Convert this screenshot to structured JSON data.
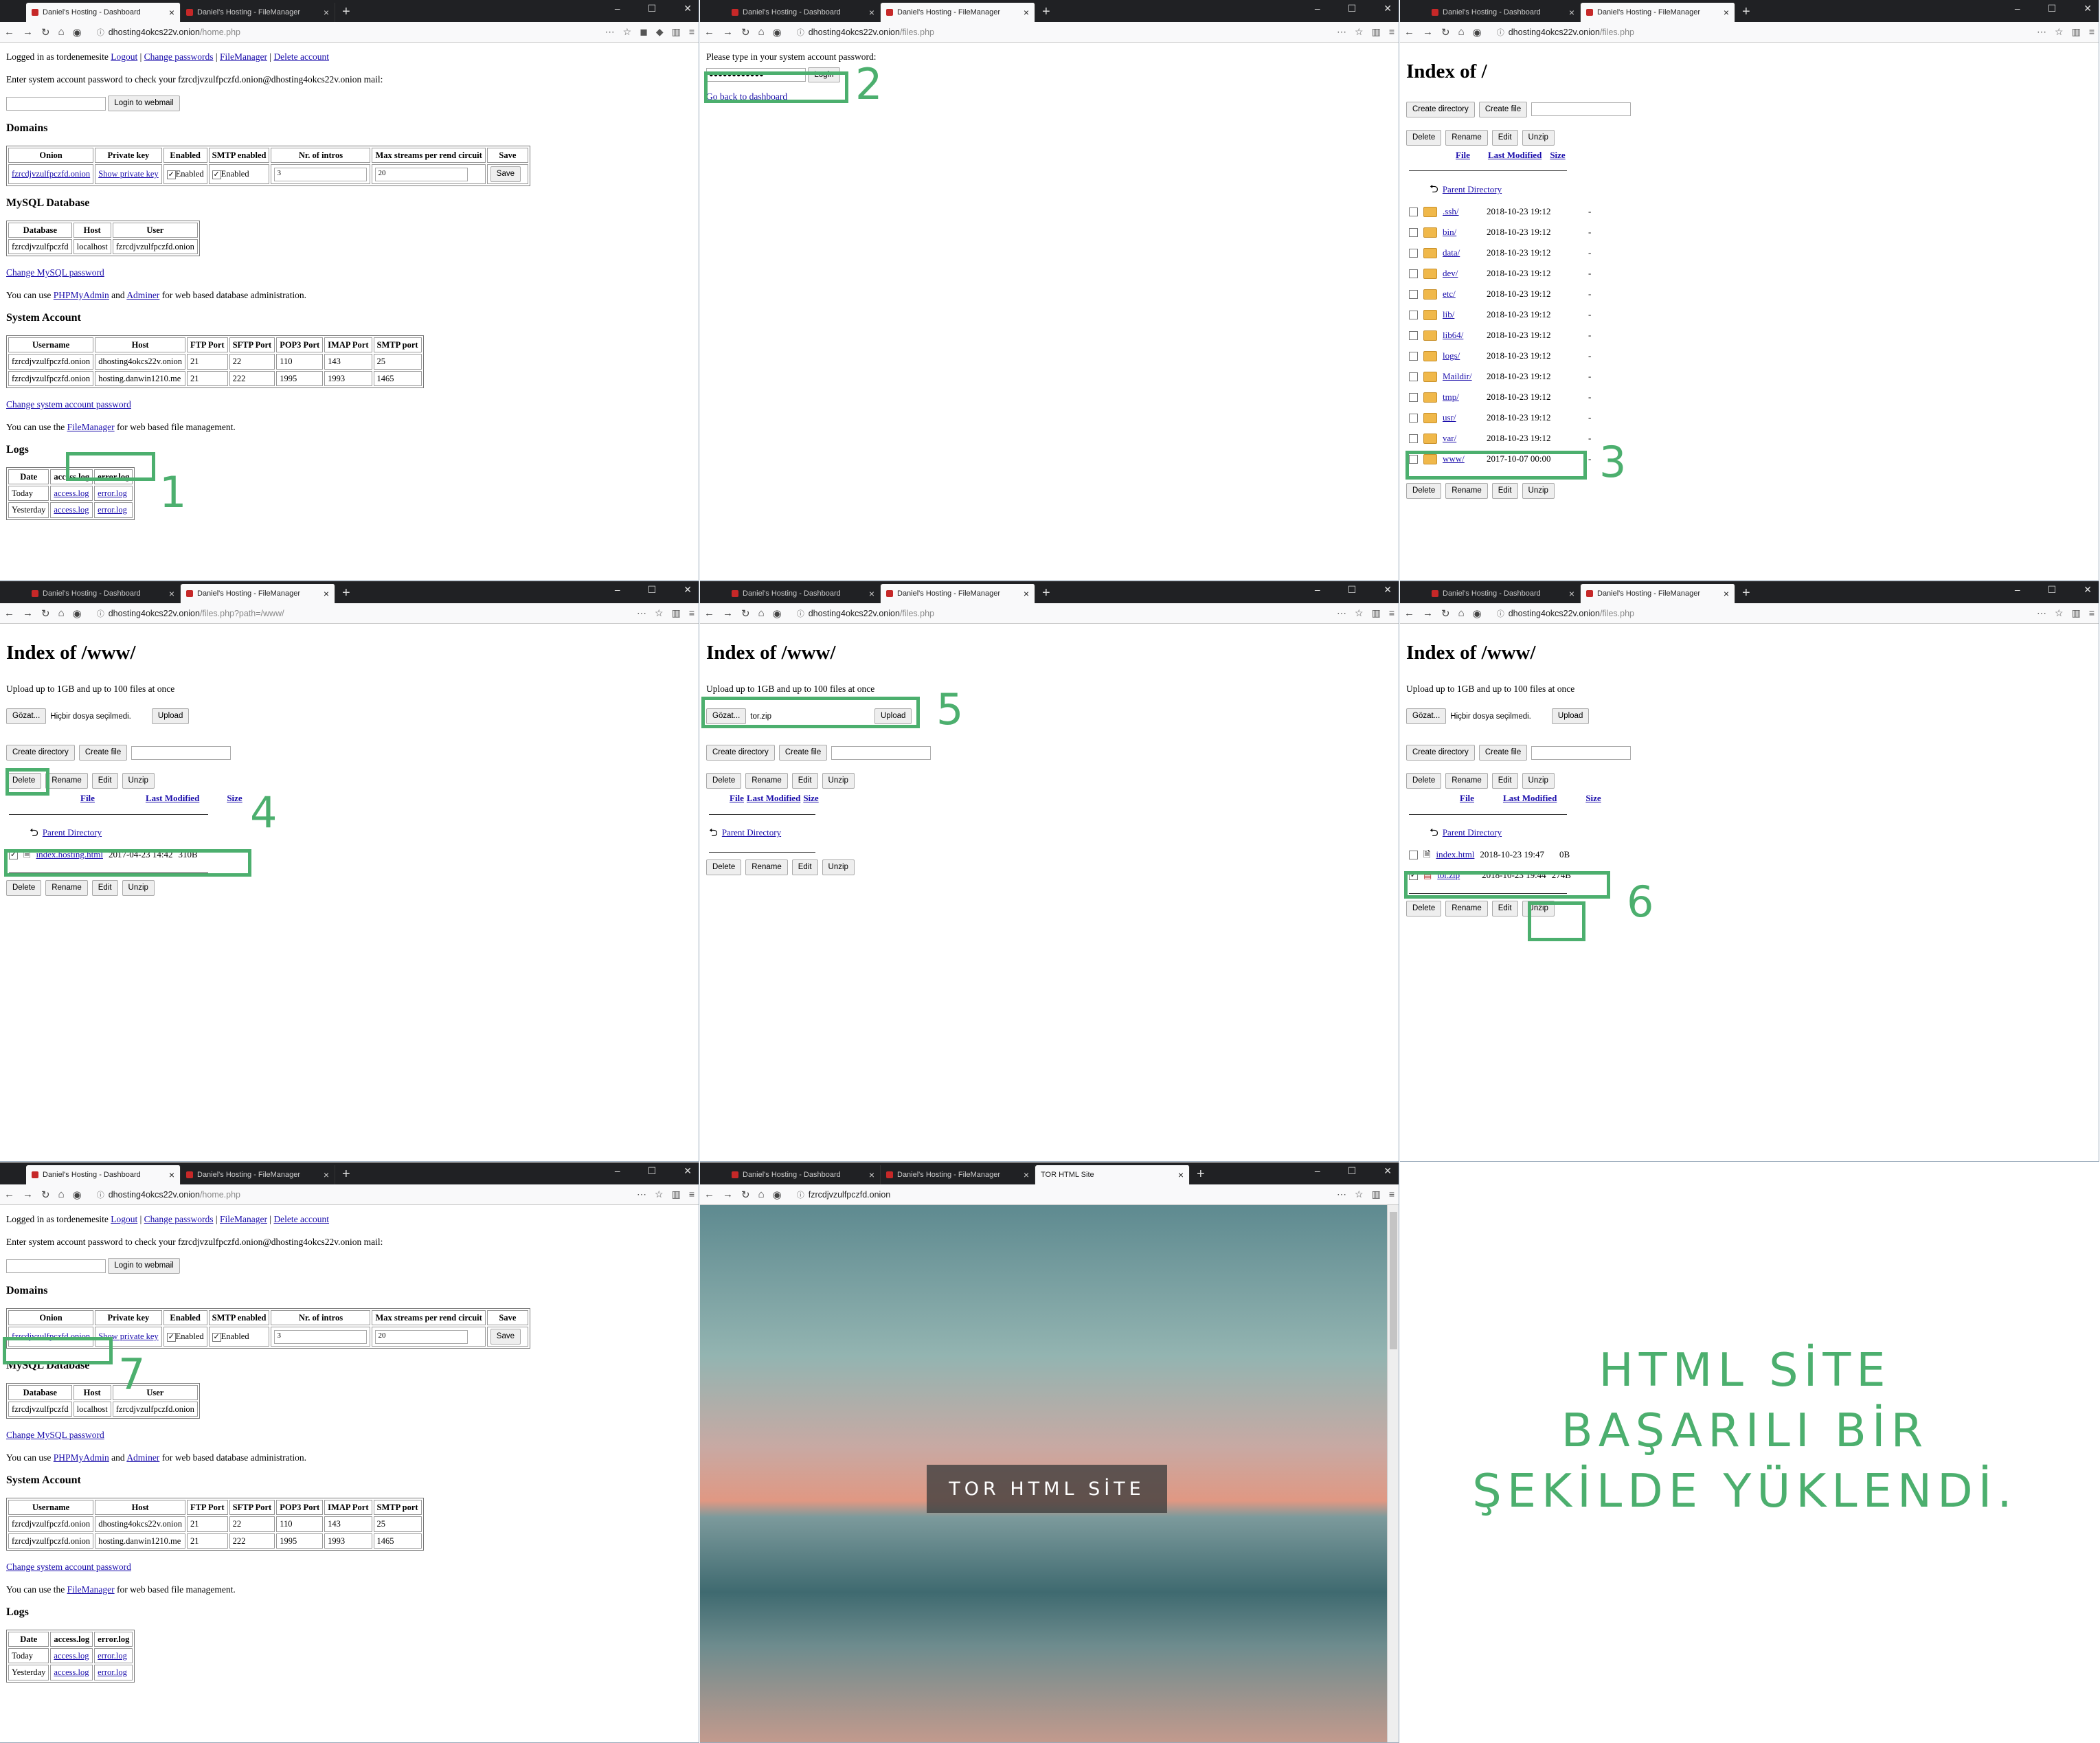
{
  "colors": {
    "accent": "#4caf6e",
    "link": "#1a0dab"
  },
  "browser": {
    "tab_dashboard": "Daniel's Hosting - Dashboard",
    "tab_filemanager": "Daniel's Hosting - FileManager",
    "tab_torsite": "TOR HTML Site",
    "new_tab": "+",
    "url_host": "dhosting4okcs22v.onion",
    "url_home": "/home.php",
    "url_files": "/files.php",
    "url_files_www": "/files.php?path=/www/",
    "url_site": "fzrcdjvzulfpczfd.onion"
  },
  "dashboard": {
    "logged_in_prefix": "Logged in as tordenemesite",
    "nav": [
      "Logout",
      "Change passwords",
      "FileManager",
      "Delete account"
    ],
    "sep": "|",
    "mail_text": "Enter system account password to check your fzrcdjvzulfpczfd.onion@dhosting4okcs22v.onion mail:",
    "login_webmail": "Login to webmail",
    "domains_title": "Domains",
    "domains_headers": [
      "Onion",
      "Private key",
      "Enabled",
      "SMTP enabled",
      "Nr. of intros",
      "Max streams per rend circuit",
      "Save"
    ],
    "domains_row": {
      "onion": "fzrcdjvzulfpczfd.onion",
      "private_key": "Show private key",
      "enabled": "Enabled",
      "smtp": "Enabled",
      "intros": "3",
      "streams": "20",
      "save": "Save"
    },
    "mysql_title": "MySQL Database",
    "mysql_headers": [
      "Database",
      "Host",
      "User"
    ],
    "mysql_row": [
      "fzrcdjvzulfpczfd",
      "localhost",
      "fzrcdjvzulfpczfd.onion"
    ],
    "change_mysql": "Change MySQL password",
    "web_admin_pre": "You can use",
    "phpmyadmin": "PHPMyAdmin",
    "and": "and",
    "adminer": "Adminer",
    "web_admin_post": "for web based database administration.",
    "sys_title": "System Account",
    "sys_headers": [
      "Username",
      "Host",
      "FTP Port",
      "SFTP Port",
      "POP3 Port",
      "IMAP Port",
      "SMTP port"
    ],
    "sys_rows": [
      [
        "fzrcdjvzulfpczfd.onion",
        "dhosting4okcs22v.onion",
        "21",
        "22",
        "110",
        "143",
        "25"
      ],
      [
        "fzrcdjvzulfpczfd.onion",
        "hosting.danwin1210.me",
        "21",
        "222",
        "1995",
        "1993",
        "1465"
      ]
    ],
    "change_sys": "Change system account password",
    "fm_pre": "You can use the",
    "fm_link": "FileManager",
    "fm_post": "for web based file management.",
    "logs_title": "Logs",
    "logs_headers": [
      "Date",
      "access.log",
      "error.log"
    ],
    "logs_rows": [
      [
        "Today",
        "access.log",
        "error.log"
      ],
      [
        "Yesterday",
        "access.log",
        "error.log"
      ]
    ]
  },
  "login": {
    "prompt": "Please type in your system account password:",
    "password": "●●●●●●●●●●●●",
    "button": "Login",
    "back": "Go back to dashboard"
  },
  "fm": {
    "index_root": "Index of /",
    "index_www": "Index of /www/",
    "upload_note": "Upload up to 1GB and up to 100 files at once",
    "browse": "Gözat...",
    "no_file": "Hiçbir dosya seçilmedi.",
    "selected_file": "tor.zip",
    "upload": "Upload",
    "create_dir": "Create directory",
    "create_file": "Create file",
    "delete": "Delete",
    "rename": "Rename",
    "edit": "Edit",
    "unzip": "Unzip",
    "col_file": "File",
    "col_modified": "Last Modified",
    "col_size": "Size",
    "parent": "Parent Directory",
    "root_dirs": [
      {
        "name": ".ssh/",
        "date": "2018-10-23 19:12",
        "size": "-"
      },
      {
        "name": "bin/",
        "date": "2018-10-23 19:12",
        "size": "-"
      },
      {
        "name": "data/",
        "date": "2018-10-23 19:12",
        "size": "-"
      },
      {
        "name": "dev/",
        "date": "2018-10-23 19:12",
        "size": "-"
      },
      {
        "name": "etc/",
        "date": "2018-10-23 19:12",
        "size": "-"
      },
      {
        "name": "lib/",
        "date": "2018-10-23 19:12",
        "size": "-"
      },
      {
        "name": "lib64/",
        "date": "2018-10-23 19:12",
        "size": "-"
      },
      {
        "name": "logs/",
        "date": "2018-10-23 19:12",
        "size": "-"
      },
      {
        "name": "Maildir/",
        "date": "2018-10-23 19:12",
        "size": "-"
      },
      {
        "name": "tmp/",
        "date": "2018-10-23 19:12",
        "size": "-"
      },
      {
        "name": "usr/",
        "date": "2018-10-23 19:12",
        "size": "-"
      },
      {
        "name": "var/",
        "date": "2018-10-23 19:12",
        "size": "-"
      },
      {
        "name": "www/",
        "date": "2017-10-07 00:00",
        "size": "-"
      }
    ],
    "www_old": {
      "name": "index.hosting.html",
      "date": "2017-04-23 14:42",
      "size": "310B"
    },
    "www_new": [
      {
        "name": "index.html",
        "date": "2018-10-23 19:47",
        "size": "0B"
      },
      {
        "name": "tor.zip",
        "date": "2018-10-23 19:44",
        "size": "274B"
      }
    ]
  },
  "site": {
    "banner": "TOR HTML SİTE"
  },
  "steps": [
    "1",
    "2",
    "3",
    "4",
    "5",
    "6",
    "7"
  ],
  "final_msg": [
    "HTML SİTE",
    "BAŞARILI BİR",
    "ŞEKİLDE YÜKLENDİ."
  ]
}
